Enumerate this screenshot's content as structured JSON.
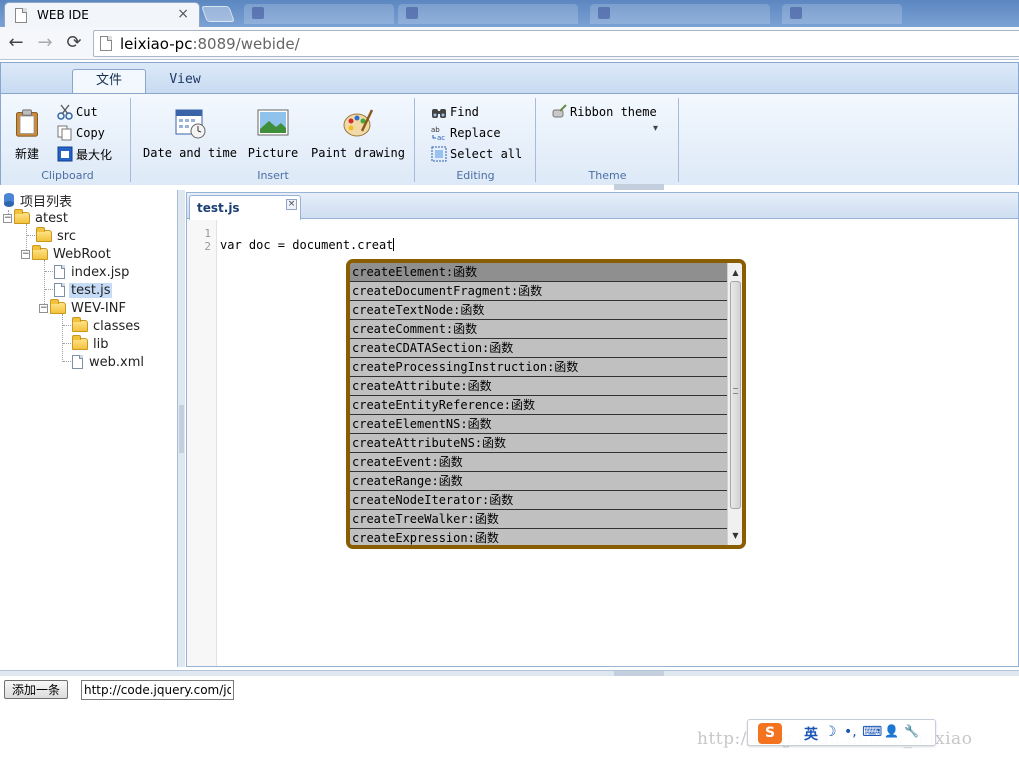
{
  "browser": {
    "tab_title": "WEB IDE",
    "tab_close": "×",
    "back": "←",
    "forward": "→",
    "reload": "⟳",
    "url_host": "leixiao-pc",
    "url_rest": ":8089/webide/"
  },
  "ribbon": {
    "tabs": [
      "文件",
      "View"
    ],
    "clipboard": {
      "new_label": "新建",
      "cut": "Cut",
      "copy": "Copy",
      "maximize": "最大化",
      "group_label": "Clipboard"
    },
    "insert": {
      "date_time": "Date and time",
      "picture": "Picture",
      "paint": "Paint drawing",
      "group_label": "Insert"
    },
    "editing": {
      "find": "Find",
      "replace": "Replace",
      "select_all": "Select all",
      "group_label": "Editing"
    },
    "theme": {
      "ribbon_theme": "Ribbon theme",
      "dropdown_arrow": "▾",
      "group_label": "Theme"
    }
  },
  "tree": {
    "root_label": "项目列表",
    "nodes": {
      "atest": "atest",
      "src": "src",
      "webroot": "WebRoot",
      "index": "index.jsp",
      "testjs": "test.js",
      "wevinf": "WEV-INF",
      "classes": "classes",
      "lib": "lib",
      "webxml": "web.xml"
    },
    "collapse_sign": "−"
  },
  "editor": {
    "tab_title": "test.js",
    "tab_close": "×",
    "line_numbers": [
      "1",
      "2"
    ],
    "code": "var doc = document.creat"
  },
  "autocomplete": {
    "items": [
      "createElement:函数",
      "createDocumentFragment:函数",
      "createTextNode:函数",
      "createComment:函数",
      "createCDATASection:函数",
      "createProcessingInstruction:函数",
      "createAttribute:函数",
      "createEntityReference:函数",
      "createElementNS:函数",
      "createAttributeNS:函数",
      "createEvent:函数",
      "createRange:函数",
      "createNodeIterator:函数",
      "createTreeWalker:函数",
      "createExpression:函数"
    ],
    "scroll_up": "▲",
    "scroll_down": "▼"
  },
  "bottom": {
    "add_button": "添加一条",
    "url_value": "http://code.jquery.com/jqu"
  },
  "watermark": "http://blog.csdn.net/ok_leixiao",
  "ime": {
    "logo": "S",
    "lang": "英",
    "items": [
      "☽",
      "•,",
      "⌨",
      "👤",
      "🔧"
    ]
  }
}
